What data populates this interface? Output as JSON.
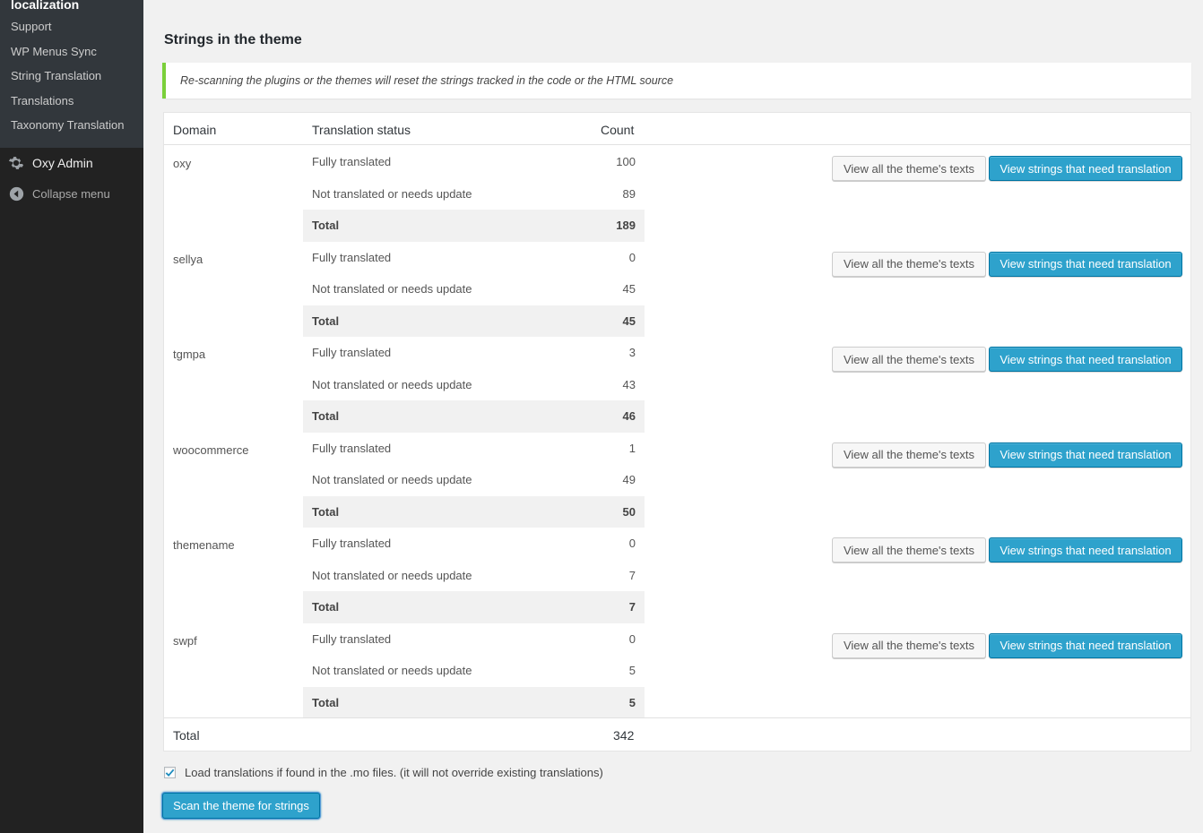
{
  "sidebar": {
    "section_title": "localization",
    "sub_items": [
      {
        "label": "Support"
      },
      {
        "label": "WP Menus Sync"
      },
      {
        "label": "String Translation"
      },
      {
        "label": "Translations"
      },
      {
        "label": "Taxonomy Translation"
      }
    ],
    "oxy_admin": {
      "label": "Oxy Admin",
      "icon": "gear-icon"
    },
    "collapse": {
      "label": "Collapse menu",
      "icon": "collapse-arrow-icon"
    }
  },
  "page": {
    "heading": "Strings in the theme",
    "notice": "Re-scanning the plugins or the themes will reset the strings tracked in the code or the HTML source"
  },
  "table": {
    "headers": {
      "domain": "Domain",
      "status": "Translation status",
      "count": "Count"
    },
    "groups": [
      {
        "domain": "oxy",
        "rows": [
          {
            "label": "Fully translated",
            "value": "100"
          },
          {
            "label": "Not translated or needs update",
            "value": "89"
          },
          {
            "label": "Total",
            "value": "189"
          }
        ]
      },
      {
        "domain": "sellya",
        "rows": [
          {
            "label": "Fully translated",
            "value": "0"
          },
          {
            "label": "Not translated or needs update",
            "value": "45"
          },
          {
            "label": "Total",
            "value": "45"
          }
        ]
      },
      {
        "domain": "tgmpa",
        "rows": [
          {
            "label": "Fully translated",
            "value": "3"
          },
          {
            "label": "Not translated or needs update",
            "value": "43"
          },
          {
            "label": "Total",
            "value": "46"
          }
        ]
      },
      {
        "domain": "woocommerce",
        "rows": [
          {
            "label": "Fully translated",
            "value": "1"
          },
          {
            "label": "Not translated or needs update",
            "value": "49"
          },
          {
            "label": "Total",
            "value": "50"
          }
        ]
      },
      {
        "domain": "themename",
        "rows": [
          {
            "label": "Fully translated",
            "value": "0"
          },
          {
            "label": "Not translated or needs update",
            "value": "7"
          },
          {
            "label": "Total",
            "value": "7"
          }
        ]
      },
      {
        "domain": "swpf",
        "rows": [
          {
            "label": "Fully translated",
            "value": "0"
          },
          {
            "label": "Not translated or needs update",
            "value": "5"
          },
          {
            "label": "Total",
            "value": "5"
          }
        ]
      }
    ],
    "view_all_label": "View all the theme's texts",
    "view_need_label": "View strings that need translation",
    "footer": {
      "label": "Total",
      "value": "342"
    }
  },
  "options": {
    "load_mo_label": "Load translations if found in the .mo files. (it will not override existing translations)",
    "load_mo_checked": true
  },
  "scan_button_label": "Scan the theme for strings",
  "colors": {
    "primary_button": "#2ea2cc",
    "notice_border": "#7ad03a",
    "sidebar_bg": "#222222"
  }
}
